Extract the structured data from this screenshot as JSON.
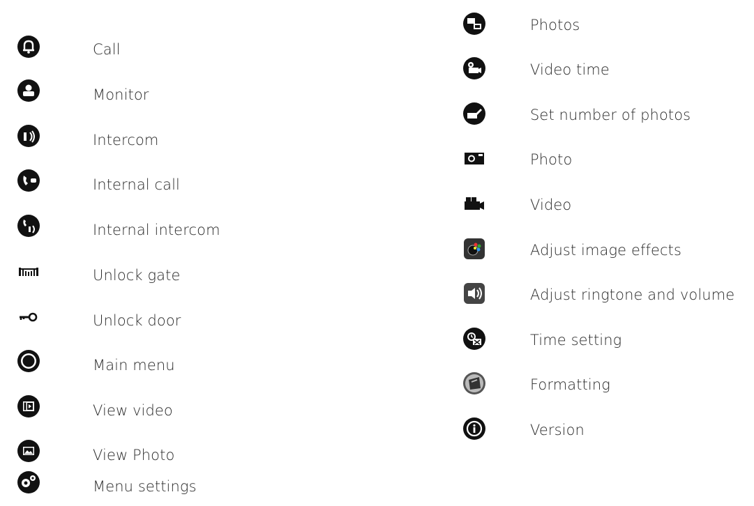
{
  "left_items": [
    {
      "icon": "bell-icon",
      "label": "Call"
    },
    {
      "icon": "person-icon",
      "label": "Monitor"
    },
    {
      "icon": "speaker-icon",
      "label": "Intercom"
    },
    {
      "icon": "handset-icon",
      "label": "Internal call"
    },
    {
      "icon": "handset-speaker-icon",
      "label": "Internal intercom"
    },
    {
      "icon": "gate-icon",
      "label": "Unlock gate"
    },
    {
      "icon": "key-icon",
      "label": "Unlock door"
    },
    {
      "icon": "ring-icon",
      "label": "Main menu"
    },
    {
      "icon": "film-icon",
      "label": "View video"
    },
    {
      "icon": "picture-icon",
      "label": "View Photo"
    },
    {
      "icon": "gear-icon",
      "label": "Menu settings"
    }
  ],
  "right_items": [
    {
      "icon": "photos-icon",
      "label": "Photos"
    },
    {
      "icon": "video-time-icon",
      "label": "Video time"
    },
    {
      "icon": "photo-count-icon",
      "label": "Set number of photos"
    },
    {
      "icon": "camera-icon",
      "label": "Photo"
    },
    {
      "icon": "video-camera-icon",
      "label": "Video"
    },
    {
      "icon": "image-effects-icon",
      "label": "Adjust image effects"
    },
    {
      "icon": "volume-icon",
      "label": "Adjust ringtone and volume"
    },
    {
      "icon": "clock-icon",
      "label": "Time setting"
    },
    {
      "icon": "format-icon",
      "label": "Formatting"
    },
    {
      "icon": "info-icon",
      "label": "Version"
    }
  ]
}
